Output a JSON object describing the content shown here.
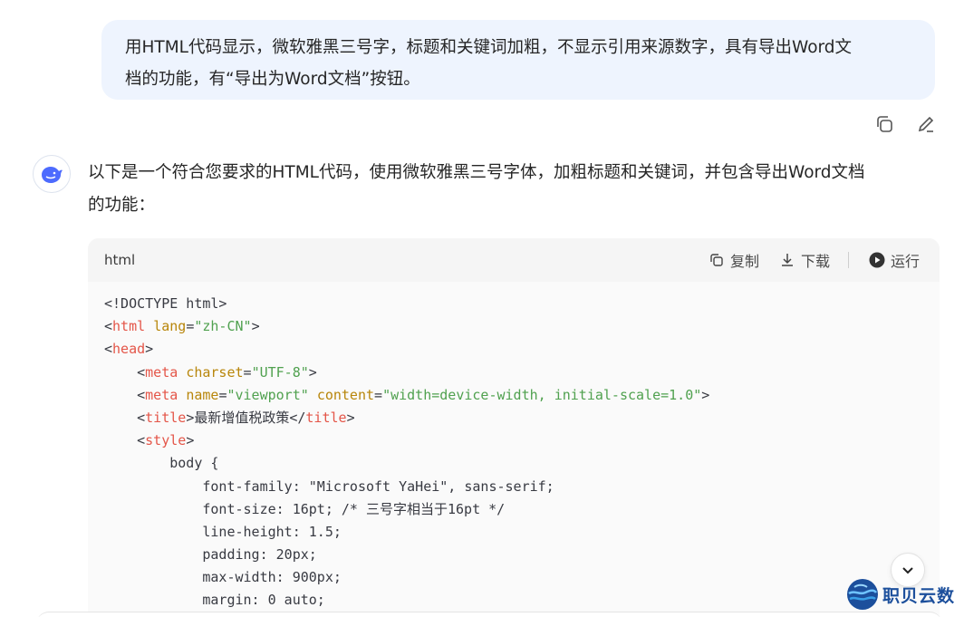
{
  "user_message": {
    "line1": "用HTML代码显示，微软雅黑三号字，标题和关键词加粗，不显示引用来源数字，具有导出Word文",
    "line2": "档的功能，有“导出为Word文档”按钮。"
  },
  "user_actions": {
    "copy_icon": "copy-icon",
    "edit_icon": "pencil-icon"
  },
  "assistant": {
    "intro_line1": "以下是一个符合您要求的HTML代码，使用微软雅黑三号字体，加粗标题和关键词，并包含导出Word文档",
    "intro_line2": "的功能："
  },
  "code_block": {
    "language": "html",
    "copy_label": "复制",
    "download_label": "下载",
    "run_label": "运行",
    "lines": [
      [
        {
          "t": "<!DOCTYPE html>",
          "c": "punc"
        }
      ],
      [
        {
          "t": "<",
          "c": "punc"
        },
        {
          "t": "html",
          "c": "tag"
        },
        {
          "t": " ",
          "c": "punc"
        },
        {
          "t": "lang",
          "c": "attr"
        },
        {
          "t": "=",
          "c": "punc"
        },
        {
          "t": "\"zh-CN\"",
          "c": "str"
        },
        {
          "t": ">",
          "c": "punc"
        }
      ],
      [
        {
          "t": "<",
          "c": "punc"
        },
        {
          "t": "head",
          "c": "tag"
        },
        {
          "t": ">",
          "c": "punc"
        }
      ],
      [
        {
          "t": "    <",
          "c": "punc"
        },
        {
          "t": "meta",
          "c": "tag"
        },
        {
          "t": " ",
          "c": "punc"
        },
        {
          "t": "charset",
          "c": "attr"
        },
        {
          "t": "=",
          "c": "punc"
        },
        {
          "t": "\"UTF-8\"",
          "c": "str"
        },
        {
          "t": ">",
          "c": "punc"
        }
      ],
      [
        {
          "t": "    <",
          "c": "punc"
        },
        {
          "t": "meta",
          "c": "tag"
        },
        {
          "t": " ",
          "c": "punc"
        },
        {
          "t": "name",
          "c": "attr"
        },
        {
          "t": "=",
          "c": "punc"
        },
        {
          "t": "\"viewport\"",
          "c": "str"
        },
        {
          "t": " ",
          "c": "punc"
        },
        {
          "t": "content",
          "c": "attr"
        },
        {
          "t": "=",
          "c": "punc"
        },
        {
          "t": "\"width=device-width, initial-scale=1.0\"",
          "c": "str"
        },
        {
          "t": ">",
          "c": "punc"
        }
      ],
      [
        {
          "t": "    <",
          "c": "punc"
        },
        {
          "t": "title",
          "c": "tag"
        },
        {
          "t": ">最新增值税政策</",
          "c": "punc"
        },
        {
          "t": "title",
          "c": "tag"
        },
        {
          "t": ">",
          "c": "punc"
        }
      ],
      [
        {
          "t": "    <",
          "c": "punc"
        },
        {
          "t": "style",
          "c": "tag"
        },
        {
          "t": ">",
          "c": "punc"
        }
      ],
      [
        {
          "t": "        body {",
          "c": "punc"
        }
      ],
      [
        {
          "t": "            font-family: \"Microsoft YaHei\", sans-serif;",
          "c": "punc"
        }
      ],
      [
        {
          "t": "            font-size: 16pt; /* 三号字相当于16pt */",
          "c": "punc"
        }
      ],
      [
        {
          "t": "            line-height: 1.5;",
          "c": "punc"
        }
      ],
      [
        {
          "t": "            padding: 20px;",
          "c": "punc"
        }
      ],
      [
        {
          "t": "            max-width: 900px;",
          "c": "punc"
        }
      ],
      [
        {
          "t": "            margin: 0 auto;",
          "c": "punc"
        }
      ]
    ]
  },
  "watermark": {
    "text": "职贝云数"
  }
}
